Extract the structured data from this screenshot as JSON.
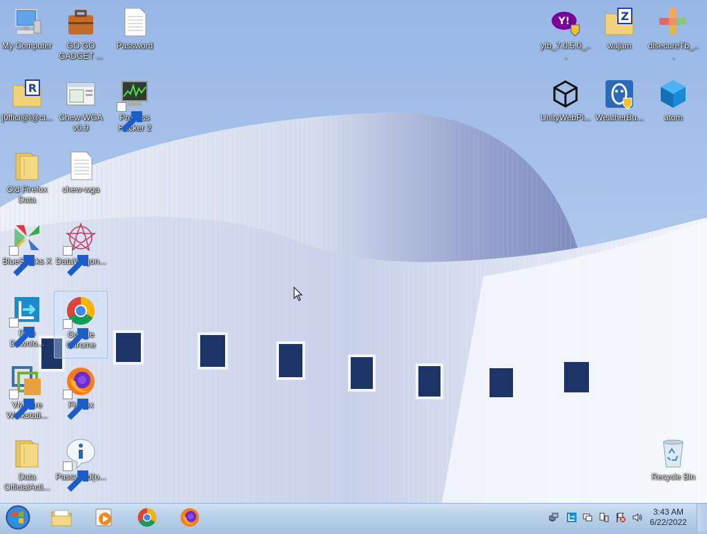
{
  "desktop": {
    "left_icons": [
      {
        "name": "my-computer-icon",
        "label": "My Computer"
      },
      {
        "name": "go-go-gadget-icon",
        "label": "GO GO GADGET ..."
      },
      {
        "name": "password-text-icon",
        "label": "Password"
      },
      {
        "name": "office-folder-icon",
        "label": "[0ffici@l@ct..."
      },
      {
        "name": "chew-wga-app-icon",
        "label": "Chew-WGA v0.9"
      },
      {
        "name": "process-hacker-icon",
        "label": "Process Hacker 2"
      },
      {
        "name": "old-firefox-data-folder-icon",
        "label": "Old Firefox Data"
      },
      {
        "name": "chew-wga-text-icon",
        "label": "chew-wga"
      },
      {
        "name": "bluestacks-icon",
        "label": "BlueStacks X"
      },
      {
        "name": "datawagon-icon",
        "label": "DataWagon..."
      },
      {
        "name": "free-download-icon",
        "label": "Free Downlo..."
      },
      {
        "name": "google-chrome-icon",
        "label": "Google Chrome"
      },
      {
        "name": "vmware-icon",
        "label": "VMware Workstati..."
      },
      {
        "name": "firefox-icon",
        "label": "Firefox"
      },
      {
        "name": "data-folder-icon",
        "label": "Data OfficialActi..."
      },
      {
        "name": "password-info-icon",
        "label": "Password(o..."
      }
    ],
    "right_icons": [
      {
        "name": "ytb-installer-icon",
        "label": "ytb_7.0.5.0_..."
      },
      {
        "name": "wajam-folder-icon",
        "label": "wajam"
      },
      {
        "name": "dlsecure-icon",
        "label": "dlsecureTb_..."
      },
      {
        "name": "unity-web-player-icon",
        "label": "UnityWebPl..."
      },
      {
        "name": "weatherbug-icon",
        "label": "WeatherBu..."
      },
      {
        "name": "atom-icon",
        "label": "atom"
      },
      {
        "name": "recycle-bin-icon",
        "label": "Recycle Bin"
      }
    ]
  },
  "taskbar": {
    "pinned": [
      {
        "name": "explorer-taskbar-icon"
      },
      {
        "name": "media-player-taskbar-icon"
      },
      {
        "name": "chrome-taskbar-icon"
      },
      {
        "name": "firefox-taskbar-icon"
      }
    ],
    "clock": {
      "time": "3:43 AM",
      "date": "6/22/2022"
    }
  },
  "colors": {
    "sky": "#a8c3e8",
    "building": "#e4e9f4",
    "taskbar": "#b9d1ea",
    "label_text": "#ffffff"
  }
}
